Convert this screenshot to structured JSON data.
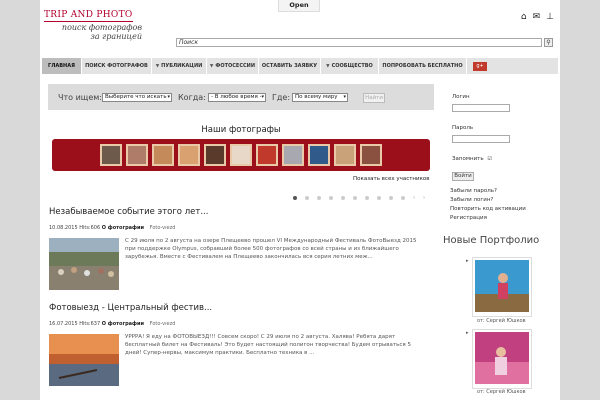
{
  "topbar": {
    "open_label": "Open"
  },
  "logo": {
    "line1": "TRIP AND PHOTO",
    "line2": "поиск фотографов",
    "line3": "за границей"
  },
  "icons": {
    "home": "home-icon",
    "mail": "mail-icon",
    "sitemap": "sitemap-icon"
  },
  "search": {
    "value": "Поиск"
  },
  "nav": {
    "items": [
      {
        "label": "ГЛАВНАЯ",
        "arrow": false,
        "active": true
      },
      {
        "label": "ПОИСК ФОТОГРАФОВ",
        "arrow": false,
        "active": false
      },
      {
        "label": "ПУБЛИКАЦИИ",
        "arrow": true,
        "active": false
      },
      {
        "label": "ФОТОСЕССИИ",
        "arrow": true,
        "active": false
      },
      {
        "label": "ОСТАВИТЬ ЗАЯВКУ",
        "arrow": false,
        "active": false
      },
      {
        "label": "СООБЩЕСТВО",
        "arrow": true,
        "active": false
      },
      {
        "label": "ПОПРОБОВАТЬ БЕСПЛАТНО",
        "arrow": false,
        "active": false
      }
    ],
    "gplus": "g+"
  },
  "filter": {
    "what_label": "Что ищем:",
    "what_value": "Выберите что искать",
    "when_label": "Когда:",
    "when_value": "- В любое время -",
    "where_label": "Где:",
    "where_value": "По всему миру",
    "submit": "Найти"
  },
  "photos": {
    "title": "Наши фотографы",
    "show_all": "Показать всех участников"
  },
  "articles": [
    {
      "title": "Незабываемое событие этого лет...",
      "date": "10.08.2015 Hits:606",
      "category": "О фотографии",
      "author": "Foto-vıezd",
      "text": "С 29 июля по 2 августа на озере Плещеево прошел VI Международный Фестиваль ФотоВыезд 2015 при поддержке Olympus, собравший более 500 фотографов со всей страны и из ближайшего зарубежья. Вместе с Фестивалем на Плещеево закончилась вся серия летних меж..."
    },
    {
      "title": "Фотовыезд - Центральный фестив...",
      "date": "16.07.2015 Hits:637",
      "category": "О фотографии",
      "author": "Foto-vıezd",
      "text": "УРРРА! Я еду на ФОТОВЫЕЗД!!!    Совсем скоро! С 29 июля по 2 августа. Халява! Ребята дарят бесплатный билет на Фестиваль! Это будет настоящий полигон творчества! Будем отрываться 5 дней! Супер-нервы, максимум практики. Бесплатно техника в ..."
    }
  ],
  "login": {
    "login_label": "Логин",
    "password_label": "Пароль",
    "remember_label": "Запомнить",
    "submit": "Войти",
    "forgot_password": "Забыли пароль?",
    "forgot_login": "Забыли логин?",
    "resend_code": "Повторить код активации",
    "register": "Регистрация"
  },
  "portfolio": {
    "title": "Новые Портфолио",
    "items": [
      {
        "author": "от: Сергей Юшков"
      },
      {
        "author": "от: Сергей Юшков"
      }
    ]
  },
  "colors": {
    "accent": "#9a0f1a",
    "logo": "#b3002d",
    "nav_bg": "#e3e3e3"
  }
}
